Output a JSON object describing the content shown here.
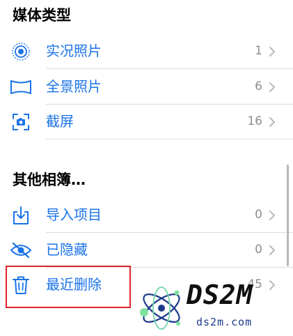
{
  "media_types": {
    "title": "媒体类型",
    "items": [
      {
        "label": "实况照片",
        "count": "1",
        "icon": "live-photo-icon"
      },
      {
        "label": "全景照片",
        "count": "6",
        "icon": "panorama-icon"
      },
      {
        "label": "截屏",
        "count": "16",
        "icon": "screenshot-icon"
      }
    ]
  },
  "other_albums": {
    "title": "其他相簿…",
    "items": [
      {
        "label": "导入项目",
        "count": "0",
        "icon": "import-icon"
      },
      {
        "label": "已隐藏",
        "count": "0",
        "icon": "hidden-eye-icon"
      },
      {
        "label": "最近删除",
        "count": "45",
        "icon": "trash-icon"
      }
    ]
  },
  "watermark": {
    "brand": "DS2M",
    "domain": "ds2m.com"
  },
  "colors": {
    "accent": "#1a73e8",
    "count_gray": "#8e8e93",
    "highlight_red": "#e0262b"
  }
}
